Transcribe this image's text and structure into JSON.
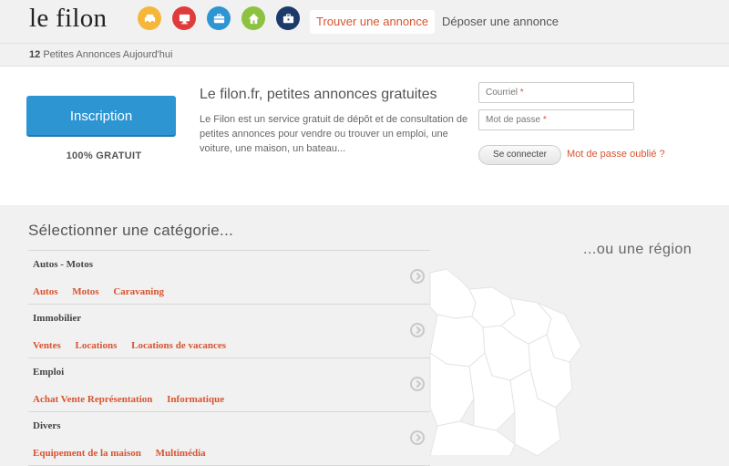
{
  "header": {
    "logo": "le filon",
    "category_icons": [
      {
        "icon": "car-icon",
        "color": "#f5b63a"
      },
      {
        "icon": "computer-icon",
        "color": "#e03b3b"
      },
      {
        "icon": "briefcase-icon",
        "color": "#2d95d2"
      },
      {
        "icon": "house-icon",
        "color": "#8cc23f"
      },
      {
        "icon": "suitcase-icon",
        "color": "#1d3a6b"
      }
    ],
    "nav": {
      "find": "Trouver une annonce",
      "post": "Déposer une annonce"
    }
  },
  "subbar": {
    "count": "12",
    "text": "Petites  Annonces  Aujourd'hui"
  },
  "login": {
    "signup_label": "Inscription",
    "free_label": "100% GRATUIT",
    "intro_title": "Le filon.fr, petites annonces gratuites",
    "intro_text": "Le Filon est un service gratuit de dépôt et de consultation de petites annonces pour vendre ou trouver un emploi, une voiture, une maison, un bateau...",
    "email_placeholder": "Courriel",
    "password_placeholder": "Mot de passe",
    "required_mark": "*",
    "connect_label": "Se connecter",
    "forgot_label": "Mot de passe oublié ?"
  },
  "categories": {
    "heading": "Sélectionner une catégorie...",
    "items": [
      {
        "name": "Autos - Motos",
        "subs": [
          "Autos",
          "Motos",
          "Caravaning"
        ]
      },
      {
        "name": "Immobilier",
        "subs": [
          "Ventes",
          "Locations",
          "Locations de vacances"
        ]
      },
      {
        "name": "Emploi",
        "subs": [
          "Achat Vente Représentation",
          "Informatique"
        ]
      },
      {
        "name": "Divers",
        "subs": [
          "Equipement de la maison",
          "Multimédia"
        ]
      }
    ]
  },
  "regions": {
    "heading": "...ou une région"
  },
  "colors": {
    "accent": "#d9532f",
    "primary_button": "#2d95d2"
  }
}
